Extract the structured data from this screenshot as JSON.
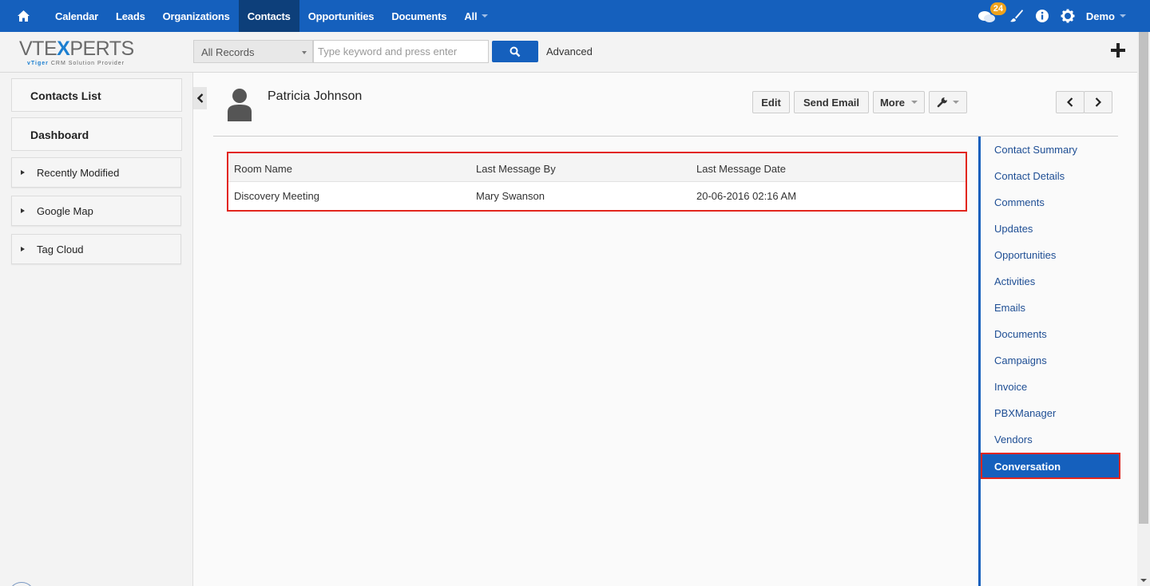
{
  "topnav": {
    "items": [
      "Calendar",
      "Leads",
      "Organizations",
      "Contacts",
      "Opportunities",
      "Documents",
      "All"
    ],
    "active": "Contacts",
    "notification_count": "24",
    "user": "Demo"
  },
  "search": {
    "logo_text_1": "VTE",
    "logo_text_x": "X",
    "logo_text_2": "PERTS",
    "logo_tagline_vt": "vTiger",
    "logo_tagline_rest": " CRM Solution Provider",
    "filter_value": "All Records",
    "placeholder": "Type keyword and press enter",
    "advanced_label": "Advanced"
  },
  "sidebar": {
    "contacts_list": "Contacts List",
    "dashboard": "Dashboard",
    "widgets": [
      "Recently Modified",
      "Google Map",
      "Tag Cloud"
    ]
  },
  "record": {
    "name": "Patricia Johnson",
    "buttons": {
      "edit": "Edit",
      "send_email": "Send Email",
      "more": "More"
    }
  },
  "conversations": {
    "columns": [
      "Room Name",
      "Last Message By",
      "Last Message Date"
    ],
    "rows": [
      {
        "room": "Discovery Meeting",
        "by": "Mary Swanson",
        "date": "20-06-2016 02:16 AM"
      }
    ]
  },
  "related": {
    "items": [
      "Contact Summary",
      "Contact Details",
      "Comments",
      "Updates",
      "Opportunities",
      "Activities",
      "Emails",
      "Documents",
      "Campaigns",
      "Invoice",
      "PBXManager",
      "Vendors"
    ],
    "active": "Conversation"
  },
  "colors": {
    "primary": "#1560bd",
    "highlight": "#e2261d",
    "badge": "#f0a21b"
  }
}
